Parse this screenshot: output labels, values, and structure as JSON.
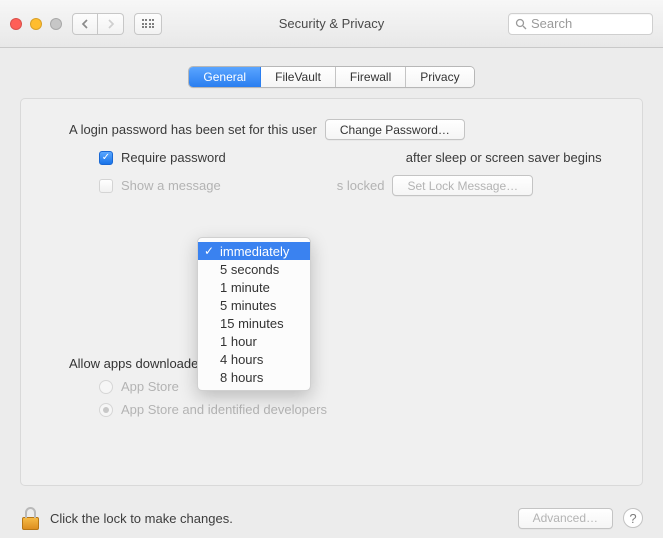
{
  "window": {
    "title": "Security & Privacy",
    "search_placeholder": "Search"
  },
  "tabs": {
    "general": "General",
    "filevault": "FileVault",
    "firewall": "Firewall",
    "privacy": "Privacy"
  },
  "login": {
    "set_text": "A login password has been set for this user",
    "change_btn": "Change Password…",
    "require_label": "Require password",
    "after_sleep": "after sleep or screen saver begins",
    "show_msg_a": "Show a message",
    "show_msg_b": "s locked",
    "set_lock_btn": "Set Lock Message…",
    "dropdown": {
      "selected": "immediately",
      "options": [
        "immediately",
        "5 seconds",
        "1 minute",
        "5 minutes",
        "15 minutes",
        "1 hour",
        "4 hours",
        "8 hours"
      ]
    }
  },
  "allow": {
    "heading": "Allow apps downloaded from:",
    "opt1": "App Store",
    "opt2": "App Store and identified developers"
  },
  "footer": {
    "lock_text": "Click the lock to make changes.",
    "advanced": "Advanced…"
  }
}
